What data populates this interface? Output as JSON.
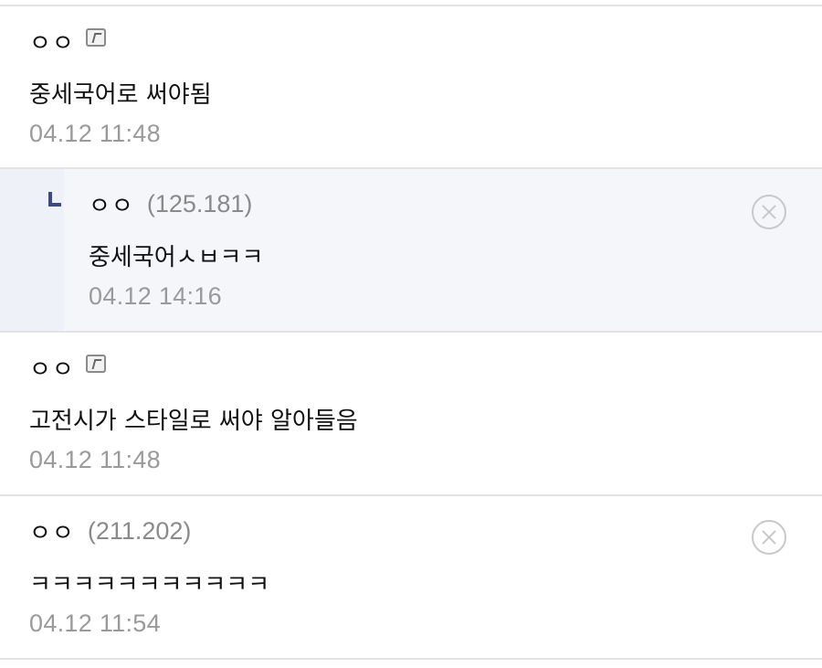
{
  "comments": [
    {
      "nickname": "ㅇㅇ",
      "ip": "",
      "gallog_icon": "gallog-icon",
      "text": "중세국어로 써야됨",
      "time": "04.12 11:48",
      "is_reply": false
    },
    {
      "nickname": "ㅇㅇ",
      "ip": "(125.181)",
      "text": "중세국어ㅅㅂㅋㅋ",
      "time": "04.12 14:16",
      "is_reply": true,
      "delete_icon": "circle-x-icon"
    },
    {
      "nickname": "ㅇㅇ",
      "ip": "",
      "gallog_icon": "gallog-icon",
      "text": "고전시가 스타일로 써야 알아들음",
      "time": "04.12 11:48",
      "is_reply": false
    },
    {
      "nickname": "ㅇㅇ",
      "ip": "(211.202)",
      "text": "ㅋㅋㅋㅋㅋㅋㅋㅋㅋㅋㅋ",
      "time": "04.12 11:54",
      "is_reply": false,
      "delete_icon": "circle-x-icon"
    }
  ],
  "colors": {
    "reply_background": "#f4f6fa",
    "reply_marker": "#3b4a86",
    "separator": "#e3e3e3",
    "meta_text": "#9a9a9a"
  }
}
